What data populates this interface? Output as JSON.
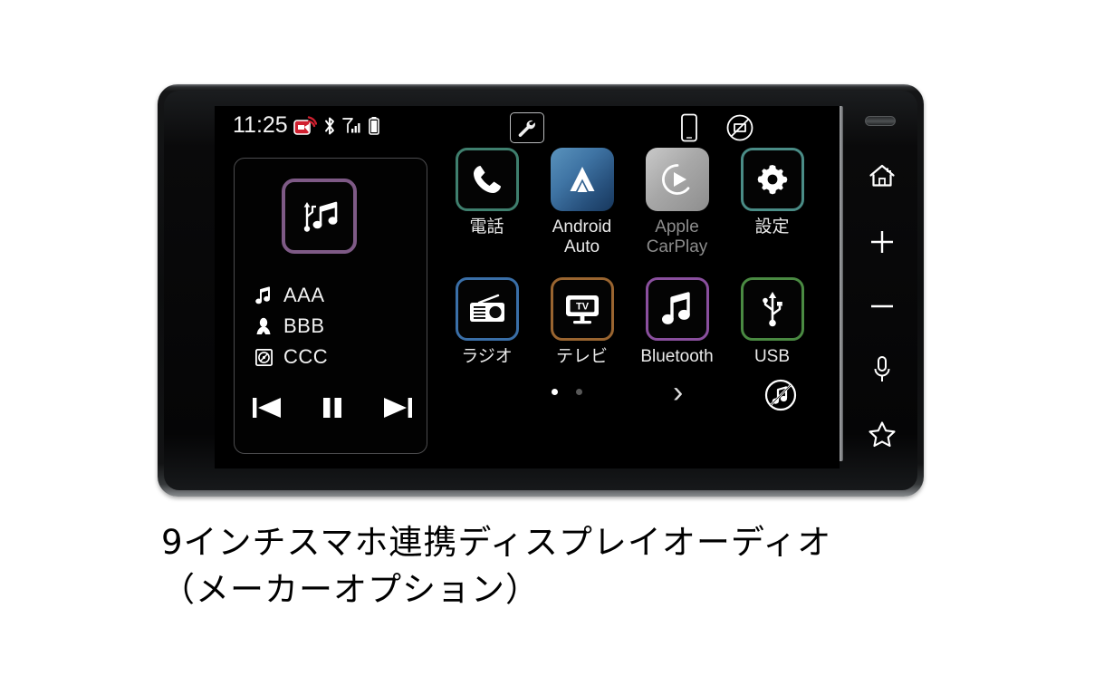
{
  "caption": {
    "line1": "9インチスマホ連携ディスプレイオーディオ",
    "line2": "（メーカーオプション）"
  },
  "status_bar": {
    "clock": "11:25",
    "icons": [
      {
        "name": "data-broadcast-icon",
        "label": "data-broadcast"
      },
      {
        "name": "bluetooth-icon",
        "label": "bluetooth"
      },
      {
        "name": "signal-bars-icon",
        "label": "signal"
      },
      {
        "name": "battery-icon",
        "label": "battery"
      }
    ],
    "center_icon": {
      "name": "wrench-icon",
      "label": "tools"
    },
    "right_icons": [
      {
        "name": "phone-device-icon",
        "label": "connected-phone"
      },
      {
        "name": "no-display-icon",
        "label": "display-off"
      }
    ]
  },
  "media": {
    "source_icon": "usb-music-icon",
    "source_border_color": "#7e5a86",
    "tracks": [
      {
        "icon": "music-note-icon",
        "text": "AAA"
      },
      {
        "icon": "artist-icon",
        "text": "BBB"
      },
      {
        "icon": "album-disc-icon",
        "text": "CCC"
      }
    ],
    "transport": [
      {
        "name": "previous-track-button",
        "icon": "skip-back-icon"
      },
      {
        "name": "pause-button",
        "icon": "pause-icon"
      },
      {
        "name": "next-track-button",
        "icon": "skip-forward-icon"
      }
    ]
  },
  "apps": {
    "row1": [
      {
        "label": "電話",
        "icon": "phone-icon",
        "border": "#3f7f6e",
        "fill": "#040404",
        "dim": false
      },
      {
        "label": "Android\nAuto",
        "label_line1": "Android",
        "label_line2": "Auto",
        "icon": "android-auto-icon",
        "border": "none",
        "fill": "#2f5f8a",
        "dim": false
      },
      {
        "label": "Apple\nCarPlay",
        "label_line1": "Apple",
        "label_line2": "CarPlay",
        "icon": "apple-carplay-icon",
        "border": "none",
        "fill": "#a8a8a8",
        "dim": true
      },
      {
        "label": "設定",
        "icon": "gear-icon",
        "border": "#4a8c86",
        "fill": "#040404",
        "dim": false
      }
    ],
    "row2": [
      {
        "label": "ラジオ",
        "icon": "radio-icon",
        "border": "#3a6fa8",
        "fill": "#040404",
        "dim": false
      },
      {
        "label": "テレビ",
        "icon": "tv-icon",
        "border": "#9a6530",
        "fill": "#040404",
        "dim": false
      },
      {
        "label": "Bluetooth",
        "icon": "music-note-icon",
        "border": "#8a4f9e",
        "fill": "#040404",
        "dim": false
      },
      {
        "label": "USB",
        "icon": "usb-icon",
        "border": "#4a8a42",
        "fill": "#040404",
        "dim": false
      }
    ]
  },
  "bottom_bar": {
    "pages": [
      {
        "active": true
      },
      {
        "active": false
      }
    ],
    "next_page_label": "›",
    "mute_icon": "audio-mute-icon"
  },
  "hardkeys": [
    {
      "name": "home-key",
      "icon": "home-icon"
    },
    {
      "name": "volume-up-key",
      "icon": "plus-icon"
    },
    {
      "name": "volume-down-key",
      "icon": "minus-icon"
    },
    {
      "name": "voice-key",
      "icon": "microphone-icon"
    },
    {
      "name": "favorite-key",
      "icon": "star-icon"
    }
  ]
}
